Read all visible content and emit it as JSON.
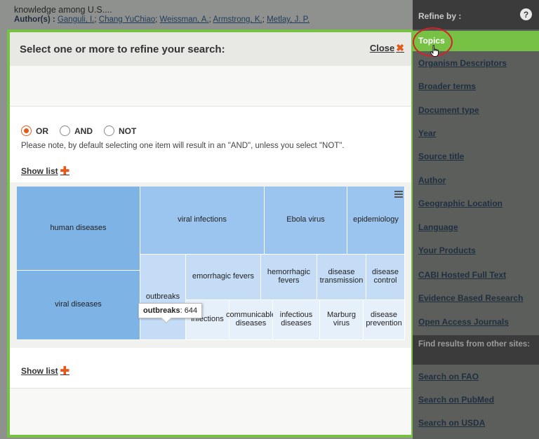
{
  "background": {
    "line1": "knowledge among U.S....",
    "authors_label": "Author(s) :",
    "authors": [
      "Ganguli, I.",
      "Chang YuChiao",
      "Weissman, A.",
      "Armstrong, K.",
      "Metlay, J. P."
    ]
  },
  "modal": {
    "title": "Select one or more to refine your search:",
    "close_label": "Close",
    "close_icon": "✖",
    "logic": {
      "options": [
        "OR",
        "AND",
        "NOT"
      ],
      "selected": "OR"
    },
    "note": "Please note, by default selecting one item will result in an \"AND\", unless you select \"NOT\".",
    "show_list_top": "Show list",
    "show_list_bottom": "Show list",
    "plus_icon": "✚"
  },
  "chart_data": {
    "type": "treemap",
    "tiles": [
      {
        "label": "human diseases"
      },
      {
        "label": "viral infections"
      },
      {
        "label": "Ebola virus"
      },
      {
        "label": "epidemiology"
      },
      {
        "label": "viral diseases"
      },
      {
        "label": "outbreaks",
        "value": 644
      },
      {
        "label": "hemorrhagic fevers",
        "visible_text": "emorrhagic fevers"
      },
      {
        "label": "hemorrhagic fevers"
      },
      {
        "label": "disease transmission"
      },
      {
        "label": "disease control"
      },
      {
        "label": "infections"
      },
      {
        "label": "communicable diseases"
      },
      {
        "label": "infectious diseases"
      },
      {
        "label": "Marburg virus"
      },
      {
        "label": "disease prevention"
      }
    ],
    "tooltip": {
      "label": "outbreaks",
      "value": "644"
    },
    "colors": {
      "level1": "#7eb3e6",
      "level2": "#9bc5ef",
      "level3": "#c4dcf6",
      "level4": "#e6f0fb"
    }
  },
  "sidebar": {
    "title": "Refine by :",
    "help_icon": "?",
    "active_item": "Topics",
    "items": [
      "Organism Descriptors",
      "Broader terms",
      "Document type",
      "Year",
      "Source title",
      "Author",
      "Geographic Location",
      "Language",
      "Your Products",
      "CABI Hosted Full Text",
      "Evidence Based Research",
      "Open Access Journals"
    ],
    "other_sites_title": "Find results from other sites:",
    "other_sites": [
      "Search on FAO",
      "Search on PubMed",
      "Search on USDA"
    ],
    "accent_color": "#77c144"
  }
}
